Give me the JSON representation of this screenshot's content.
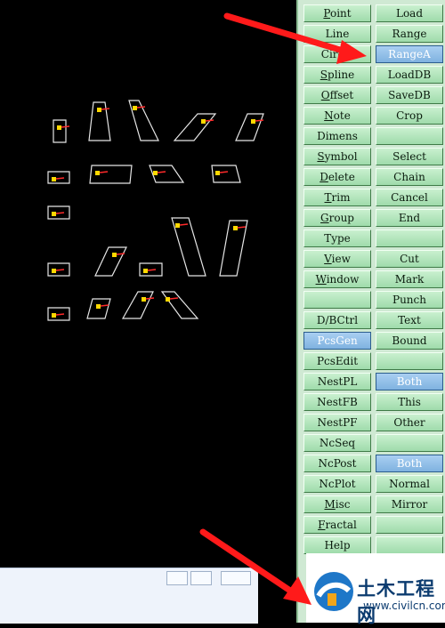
{
  "panel": {
    "rows": [
      {
        "left": {
          "label": "Point",
          "u": 0
        },
        "right": {
          "label": "Load"
        }
      },
      {
        "left": {
          "label": "Line"
        },
        "right": {
          "label": "Range"
        }
      },
      {
        "left": {
          "label": "Circle"
        },
        "right": {
          "label": "RangeA",
          "active": true
        }
      },
      {
        "left": {
          "label": "Spline",
          "u": 0
        },
        "right": {
          "label": "LoadDB"
        }
      },
      {
        "left": {
          "label": "Offset",
          "u": 0
        },
        "right": {
          "label": "SaveDB"
        }
      },
      {
        "left": {
          "label": "Note",
          "u": 0
        },
        "right": {
          "label": "Crop"
        }
      },
      {
        "left": {
          "label": "Dimens"
        },
        "right": {
          "label": ""
        }
      },
      {
        "left": {
          "label": "Symbol",
          "u": 0
        },
        "right": {
          "label": "Select"
        }
      },
      {
        "left": {
          "label": "Delete",
          "u": 0
        },
        "right": {
          "label": "Chain"
        }
      },
      {
        "left": {
          "label": "Trim",
          "u": 0
        },
        "right": {
          "label": "Cancel"
        }
      },
      {
        "left": {
          "label": "Group",
          "u": 0
        },
        "right": {
          "label": "End"
        }
      },
      {
        "left": {
          "label": "Type"
        },
        "right": {
          "label": ""
        }
      },
      {
        "left": {
          "label": "View",
          "u": 0
        },
        "right": {
          "label": "Cut"
        }
      },
      {
        "left": {
          "label": "Window",
          "u": 0
        },
        "right": {
          "label": "Mark"
        }
      },
      {
        "left": {
          "label": ""
        },
        "right": {
          "label": "Punch"
        }
      },
      {
        "left": {
          "label": "D/BCtrl"
        },
        "right": {
          "label": "Text"
        }
      },
      {
        "left": {
          "label": "PcsGen",
          "active": true
        },
        "right": {
          "label": "Bound"
        }
      },
      {
        "left": {
          "label": "PcsEdit"
        },
        "right": {
          "label": ""
        }
      },
      {
        "left": {
          "label": "NestPL"
        },
        "right": {
          "label": "Both",
          "active": true
        }
      },
      {
        "left": {
          "label": "NestFB"
        },
        "right": {
          "label": "This"
        }
      },
      {
        "left": {
          "label": "NestPF"
        },
        "right": {
          "label": "Other"
        }
      },
      {
        "left": {
          "label": "NcSeq"
        },
        "right": {
          "label": ""
        }
      },
      {
        "left": {
          "label": "NcPost"
        },
        "right": {
          "label": "Both",
          "active": true
        }
      },
      {
        "left": {
          "label": "NcPlot"
        },
        "right": {
          "label": "Normal"
        }
      },
      {
        "left": {
          "label": "Misc",
          "u": 0
        },
        "right": {
          "label": "Mirror"
        }
      },
      {
        "left": {
          "label": "Fractal",
          "u": 0
        },
        "right": {
          "label": ""
        }
      },
      {
        "left": {
          "label": "Help"
        },
        "right": {
          "label": ""
        }
      }
    ]
  },
  "watermark": {
    "site": "土木工程网",
    "url": "www.civilcn.com"
  },
  "colors": {
    "arrow": "#ff1a1a",
    "shape_outline": "#e6e6e6",
    "marker": "#ffd800",
    "marker_line": "#ff2a2a"
  }
}
